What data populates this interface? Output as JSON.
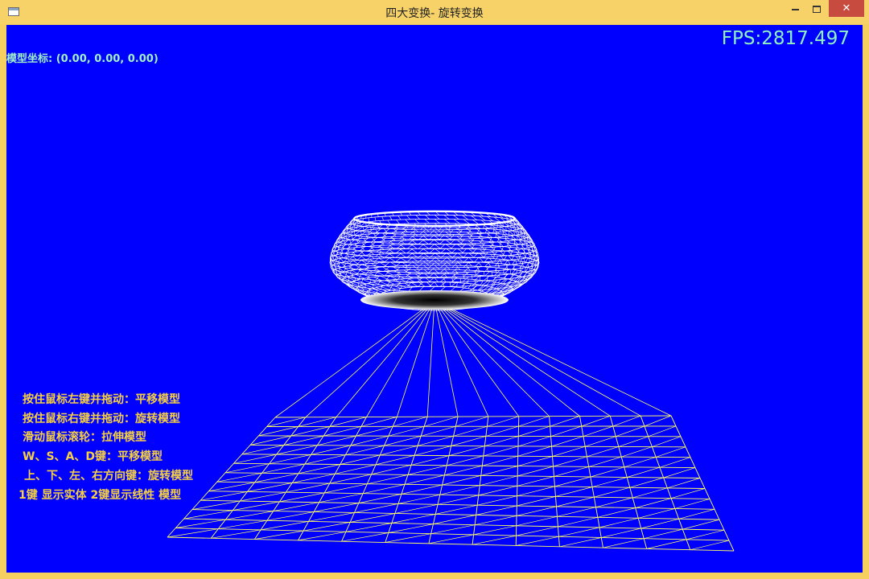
{
  "window": {
    "title": "四大变换- 旋转变换",
    "controls": {
      "minimize_label": "",
      "maximize_label": "",
      "close_label": "✕"
    }
  },
  "hud": {
    "model_coords": "模型坐标: (0.00, 0.00, 0.00)",
    "fps": "FPS:2817.497"
  },
  "help": [
    "按住鼠标左键并拖动：平移模型",
    "按住鼠标右键并拖动：旋转模型",
    "滑动鼠标滚轮：拉伸模型",
    "W、S、A、D键：平移模型",
    "上、下、左、右方向键：旋转模型",
    "1键 显示实体  2键显示线性 模型"
  ],
  "colors": {
    "background": "#0000fe",
    "wireframe": "#ffffff",
    "grid": "#ffff66",
    "help_text": "#f5d042",
    "hud_text": "#8ff0c4"
  }
}
